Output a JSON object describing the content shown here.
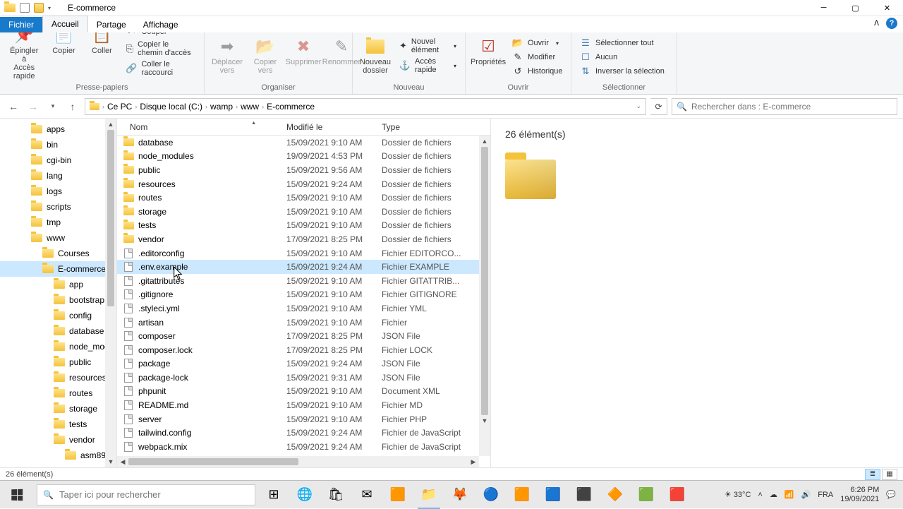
{
  "window": {
    "title": "E-commerce"
  },
  "tabs": {
    "file": "Fichier",
    "home": "Accueil",
    "share": "Partage",
    "view": "Affichage"
  },
  "ribbon": {
    "clipboard": {
      "label": "Presse-papiers",
      "pin": "Épingler à\nAccès rapide",
      "copy": "Copier",
      "paste": "Coller",
      "cut": "Couper",
      "copy_path": "Copier le chemin d'accès",
      "paste_shortcut": "Coller le raccourci"
    },
    "organize": {
      "label": "Organiser",
      "move_to": "Déplacer\nvers",
      "copy_to": "Copier\nvers",
      "delete": "Supprimer",
      "rename": "Renommer"
    },
    "new": {
      "label": "Nouveau",
      "new_folder": "Nouveau\ndossier",
      "new_item": "Nouvel élément",
      "easy_access": "Accès rapide"
    },
    "open": {
      "label": "Ouvrir",
      "properties": "Propriétés",
      "open": "Ouvrir",
      "edit": "Modifier",
      "history": "Historique"
    },
    "select": {
      "label": "Sélectionner",
      "select_all": "Sélectionner tout",
      "select_none": "Aucun",
      "invert": "Inverser la sélection"
    }
  },
  "breadcrumb": [
    "Ce PC",
    "Disque local (C:)",
    "wamp",
    "www",
    "E-commerce"
  ],
  "search": {
    "placeholder": "Rechercher dans : E-commerce"
  },
  "columns": {
    "name": "Nom",
    "modified": "Modifié le",
    "type": "Type"
  },
  "tree": [
    {
      "name": "apps",
      "indent": 44
    },
    {
      "name": "bin",
      "indent": 44
    },
    {
      "name": "cgi-bin",
      "indent": 44
    },
    {
      "name": "lang",
      "indent": 44
    },
    {
      "name": "logs",
      "indent": 44
    },
    {
      "name": "scripts",
      "indent": 44
    },
    {
      "name": "tmp",
      "indent": 44
    },
    {
      "name": "www",
      "indent": 44
    },
    {
      "name": "Courses",
      "indent": 60
    },
    {
      "name": "E-commerce",
      "indent": 60,
      "selected": true
    },
    {
      "name": "app",
      "indent": 76
    },
    {
      "name": "bootstrap",
      "indent": 76
    },
    {
      "name": "config",
      "indent": 76
    },
    {
      "name": "database",
      "indent": 76
    },
    {
      "name": "node_modules",
      "indent": 76
    },
    {
      "name": "public",
      "indent": 76
    },
    {
      "name": "resources",
      "indent": 76
    },
    {
      "name": "routes",
      "indent": 76
    },
    {
      "name": "storage",
      "indent": 76
    },
    {
      "name": "tests",
      "indent": 76
    },
    {
      "name": "vendor",
      "indent": 76
    },
    {
      "name": "asm89",
      "indent": 92
    }
  ],
  "files": [
    {
      "name": "database",
      "mod": "15/09/2021 9:10 AM",
      "type": "Dossier de fichiers",
      "icon": "folder"
    },
    {
      "name": "node_modules",
      "mod": "19/09/2021 4:53 PM",
      "type": "Dossier de fichiers",
      "icon": "folder"
    },
    {
      "name": "public",
      "mod": "15/09/2021 9:56 AM",
      "type": "Dossier de fichiers",
      "icon": "folder"
    },
    {
      "name": "resources",
      "mod": "15/09/2021 9:24 AM",
      "type": "Dossier de fichiers",
      "icon": "folder"
    },
    {
      "name": "routes",
      "mod": "15/09/2021 9:10 AM",
      "type": "Dossier de fichiers",
      "icon": "folder"
    },
    {
      "name": "storage",
      "mod": "15/09/2021 9:10 AM",
      "type": "Dossier de fichiers",
      "icon": "folder"
    },
    {
      "name": "tests",
      "mod": "15/09/2021 9:10 AM",
      "type": "Dossier de fichiers",
      "icon": "folder"
    },
    {
      "name": "vendor",
      "mod": "17/09/2021 8:25 PM",
      "type": "Dossier de fichiers",
      "icon": "folder"
    },
    {
      "name": ".editorconfig",
      "mod": "15/09/2021 9:10 AM",
      "type": "Fichier EDITORCO...",
      "icon": "file"
    },
    {
      "name": ".env.example",
      "mod": "15/09/2021 9:24 AM",
      "type": "Fichier EXAMPLE",
      "icon": "file",
      "selected": true
    },
    {
      "name": ".gitattributes",
      "mod": "15/09/2021 9:10 AM",
      "type": "Fichier GITATTRIB...",
      "icon": "file"
    },
    {
      "name": ".gitignore",
      "mod": "15/09/2021 9:10 AM",
      "type": "Fichier GITIGNORE",
      "icon": "file"
    },
    {
      "name": ".styleci.yml",
      "mod": "15/09/2021 9:10 AM",
      "type": "Fichier YML",
      "icon": "file"
    },
    {
      "name": "artisan",
      "mod": "15/09/2021 9:10 AM",
      "type": "Fichier",
      "icon": "file"
    },
    {
      "name": "composer",
      "mod": "17/09/2021 8:25 PM",
      "type": "JSON File",
      "icon": "file"
    },
    {
      "name": "composer.lock",
      "mod": "17/09/2021 8:25 PM",
      "type": "Fichier LOCK",
      "icon": "file"
    },
    {
      "name": "package",
      "mod": "15/09/2021 9:24 AM",
      "type": "JSON File",
      "icon": "file"
    },
    {
      "name": "package-lock",
      "mod": "15/09/2021 9:31 AM",
      "type": "JSON File",
      "icon": "file"
    },
    {
      "name": "phpunit",
      "mod": "15/09/2021 9:10 AM",
      "type": "Document XML",
      "icon": "file"
    },
    {
      "name": "README.md",
      "mod": "15/09/2021 9:10 AM",
      "type": "Fichier MD",
      "icon": "file"
    },
    {
      "name": "server",
      "mod": "15/09/2021 9:10 AM",
      "type": "Fichier PHP",
      "icon": "file"
    },
    {
      "name": "tailwind.config",
      "mod": "15/09/2021 9:24 AM",
      "type": "Fichier de JavaScript",
      "icon": "file"
    },
    {
      "name": "webpack.mix",
      "mod": "15/09/2021 9:24 AM",
      "type": "Fichier de JavaScript",
      "icon": "file"
    }
  ],
  "preview": {
    "count": "26 élément(s)"
  },
  "status": {
    "text": "26 élément(s)"
  },
  "taskbar": {
    "search_placeholder": "Taper ici pour rechercher",
    "weather": "33°C",
    "lang": "FRA",
    "time": "6:26 PM",
    "date": "19/09/2021"
  }
}
